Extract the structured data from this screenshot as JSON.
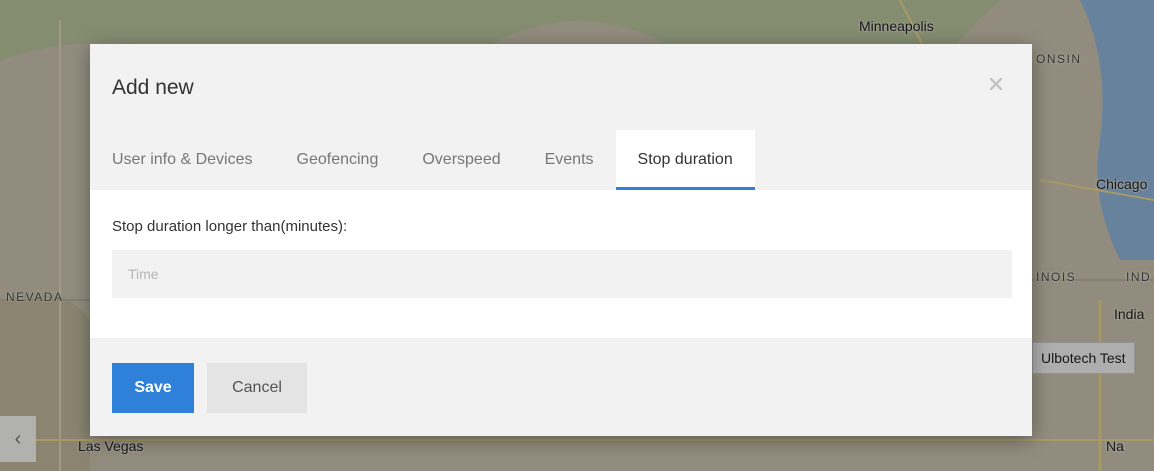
{
  "map": {
    "labels": {
      "minneapolis": "Minneapolis",
      "wisconsin": "ONSIN",
      "chicago": "Chicago",
      "nevada": "NEVADA",
      "illinois": "INOIS",
      "indiana_region": "IND",
      "indianapolis": "India",
      "las_vegas": "Las Vegas",
      "nashville": "Na"
    },
    "device_chip": "Ulbotech Test",
    "prev_arrow": "‹"
  },
  "modal": {
    "title": "Add new",
    "close_icon": "close-icon",
    "tabs": [
      {
        "label": "User info & Devices",
        "active": false
      },
      {
        "label": "Geofencing",
        "active": false
      },
      {
        "label": "Overspeed",
        "active": false
      },
      {
        "label": "Events",
        "active": false
      },
      {
        "label": "Stop duration",
        "active": true
      }
    ],
    "body": {
      "field_label": "Stop duration longer than(minutes):",
      "time_placeholder": "Time",
      "time_value": ""
    },
    "footer": {
      "save_label": "Save",
      "cancel_label": "Cancel"
    }
  },
  "colors": {
    "accent": "#2f80d8",
    "overlay": "rgba(0,0,0,0.28)",
    "modal_bg": "#f2f2f2"
  }
}
